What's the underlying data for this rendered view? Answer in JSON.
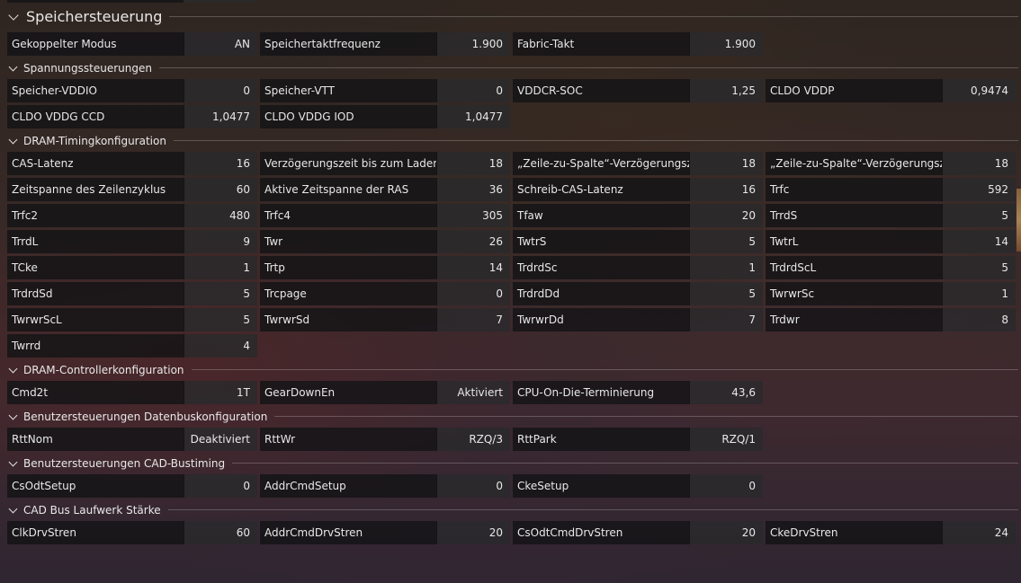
{
  "sections": [
    {
      "id": "speichersteuerung",
      "level": 1,
      "title": "Speichersteuerung",
      "items": [
        {
          "label": "Gekoppelter Modus",
          "value": "AN"
        },
        {
          "label": "Speichertaktfrequenz",
          "value": "1.900"
        },
        {
          "label": "Fabric-Takt",
          "value": "1.900"
        }
      ]
    },
    {
      "id": "spannungssteuerungen",
      "level": 2,
      "title": "Spannungssteuerungen",
      "items": [
        {
          "label": "Speicher-VDDIO",
          "value": "0"
        },
        {
          "label": "Speicher-VTT",
          "value": "0"
        },
        {
          "label": "VDDCR-SOC",
          "value": "1,25"
        },
        {
          "label": "CLDO VDDP",
          "value": "0,9474"
        },
        {
          "label": "CLDO VDDG CCD",
          "value": "1,0477"
        },
        {
          "label": "CLDO VDDG IOD",
          "value": "1,0477"
        }
      ]
    },
    {
      "id": "dram-timing",
      "level": 2,
      "title": "DRAM-Timingkonfiguration",
      "items": [
        {
          "label": "CAS-Latenz",
          "value": "16"
        },
        {
          "label": "Verzögerungszeit bis zum Laden ...",
          "value": "18"
        },
        {
          "label": "„Zeile-zu-Spalte“-Verzögerungsze...",
          "value": "18"
        },
        {
          "label": "„Zeile-zu-Spalte“-Verzögerungsze...",
          "value": "18"
        },
        {
          "label": "Zeitspanne des Zeilenzyklus",
          "value": "60"
        },
        {
          "label": "Aktive Zeitspanne der RAS",
          "value": "36"
        },
        {
          "label": "Schreib-CAS-Latenz",
          "value": "16"
        },
        {
          "label": "Trfc",
          "value": "592"
        },
        {
          "label": "Trfc2",
          "value": "480"
        },
        {
          "label": "Trfc4",
          "value": "305"
        },
        {
          "label": "Tfaw",
          "value": "20"
        },
        {
          "label": "TrrdS",
          "value": "5"
        },
        {
          "label": "TrrdL",
          "value": "9"
        },
        {
          "label": "Twr",
          "value": "26"
        },
        {
          "label": "TwtrS",
          "value": "5"
        },
        {
          "label": "TwtrL",
          "value": "14"
        },
        {
          "label": "TCke",
          "value": "1"
        },
        {
          "label": "Trtp",
          "value": "14"
        },
        {
          "label": "TrdrdSc",
          "value": "1"
        },
        {
          "label": "TrdrdScL",
          "value": "5"
        },
        {
          "label": "TrdrdSd",
          "value": "5"
        },
        {
          "label": "Trcpage",
          "value": "0"
        },
        {
          "label": "TrdrdDd",
          "value": "5"
        },
        {
          "label": "TwrwrSc",
          "value": "1"
        },
        {
          "label": "TwrwrScL",
          "value": "5"
        },
        {
          "label": "TwrwrSd",
          "value": "7"
        },
        {
          "label": "TwrwrDd",
          "value": "7"
        },
        {
          "label": "Trdwr",
          "value": "8"
        },
        {
          "label": "Twrrd",
          "value": "4"
        }
      ]
    },
    {
      "id": "dram-controller",
      "level": 2,
      "title": "DRAM-Controllerkonfiguration",
      "items": [
        {
          "label": "Cmd2t",
          "value": "1T"
        },
        {
          "label": "GearDownEn",
          "value": "Aktiviert"
        },
        {
          "label": "CPU-On-Die-Terminierung",
          "value": "43,6"
        }
      ]
    },
    {
      "id": "datenbus",
      "level": 2,
      "title": "Benutzersteuerungen Datenbuskonfiguration",
      "items": [
        {
          "label": "RttNom",
          "value": "Deaktiviert"
        },
        {
          "label": "RttWr",
          "value": "RZQ/3"
        },
        {
          "label": "RttPark",
          "value": "RZQ/1"
        }
      ]
    },
    {
      "id": "cad-bustiming",
      "level": 2,
      "title": "Benutzersteuerungen CAD-Bustiming",
      "items": [
        {
          "label": "CsOdtSetup",
          "value": "0"
        },
        {
          "label": "AddrCmdSetup",
          "value": "0"
        },
        {
          "label": "CkeSetup",
          "value": "0"
        }
      ]
    },
    {
      "id": "cad-bus-laufwerk",
      "level": 2,
      "title": "CAD Bus Laufwerk Stärke",
      "items": [
        {
          "label": "ClkDrvStren",
          "value": "60"
        },
        {
          "label": "AddrCmdDrvStren",
          "value": "20"
        },
        {
          "label": "CsOdtCmdDrvStren",
          "value": "20"
        },
        {
          "label": "CkeDrvStren",
          "value": "24"
        }
      ]
    }
  ]
}
